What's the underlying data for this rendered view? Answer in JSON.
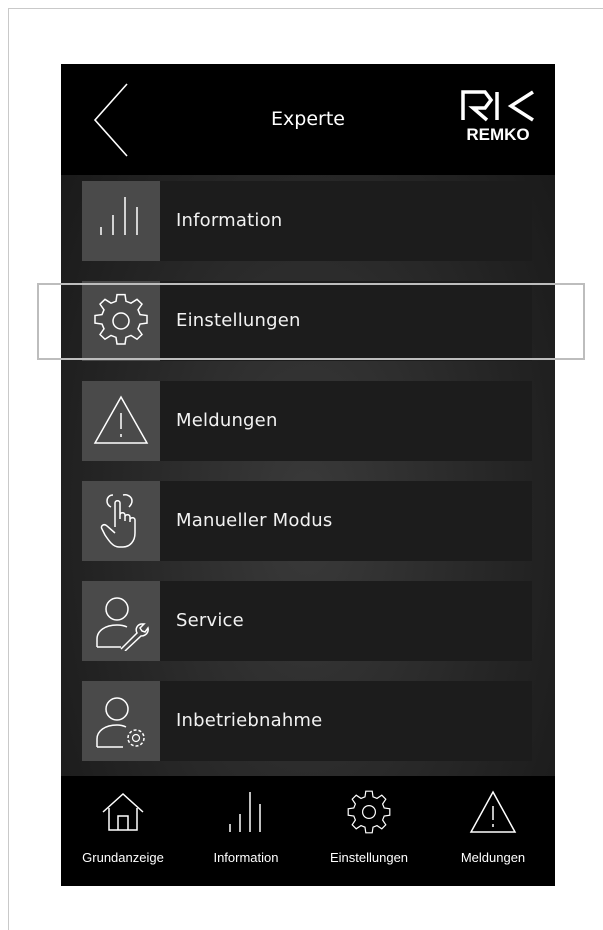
{
  "header": {
    "title": "Experte",
    "logo_text": "REMKO"
  },
  "menu": [
    {
      "label": "Information",
      "icon": "bars-icon"
    },
    {
      "label": "Einstellungen",
      "icon": "gear-icon"
    },
    {
      "label": "Meldungen",
      "icon": "warning-icon"
    },
    {
      "label": "Manueller Modus",
      "icon": "hand-pointer-icon"
    },
    {
      "label": "Service",
      "icon": "user-wrench-icon"
    },
    {
      "label": "Inbetriebnahme",
      "icon": "user-gear-icon"
    }
  ],
  "bottom_nav": [
    {
      "label": "Grundanzeige",
      "icon": "home-icon"
    },
    {
      "label": "Information",
      "icon": "bars-icon"
    },
    {
      "label": "Einstellungen",
      "icon": "gear-icon"
    },
    {
      "label": "Meldungen",
      "icon": "warning-icon"
    }
  ],
  "colors": {
    "background": "#262626",
    "header": "#000000",
    "item": "#1c1c1c",
    "icon_box": "#4a4a4a",
    "text": "#ffffff"
  }
}
